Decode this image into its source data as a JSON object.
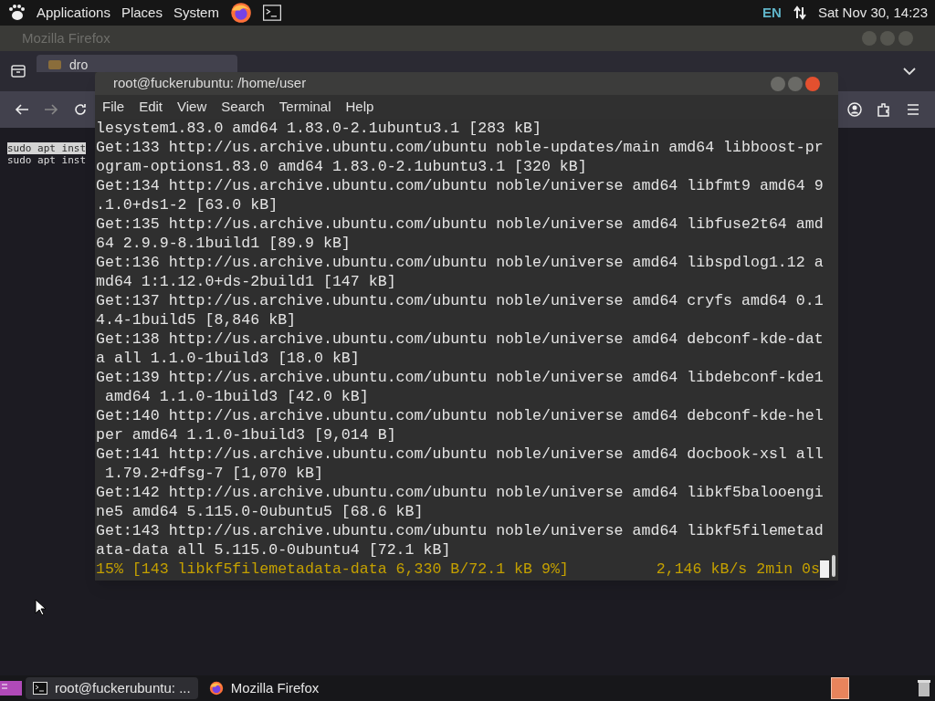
{
  "top_panel": {
    "menus": [
      "Applications",
      "Places",
      "System"
    ],
    "keyboard_layout": "EN",
    "clock": "Sat Nov 30, 14:23"
  },
  "browser": {
    "title": "Mozilla Firefox",
    "tab": {
      "title": "dro"
    },
    "content_lines": [
      {
        "text": "sudo apt inst",
        "selected": true
      },
      {
        "text": "sudo apt inst",
        "selected": false
      }
    ]
  },
  "terminal": {
    "title": "root@fuckerubuntu: /home/user",
    "menus": [
      "File",
      "Edit",
      "View",
      "Search",
      "Terminal",
      "Help"
    ],
    "lines": [
      "lesystem1.83.0 amd64 1.83.0-2.1ubuntu3.1 [283 kB]",
      "Get:133 http://us.archive.ubuntu.com/ubuntu noble-updates/main amd64 libboost-pr",
      "ogram-options1.83.0 amd64 1.83.0-2.1ubuntu3.1 [320 kB]",
      "Get:134 http://us.archive.ubuntu.com/ubuntu noble/universe amd64 libfmt9 amd64 9",
      ".1.0+ds1-2 [63.0 kB]",
      "Get:135 http://us.archive.ubuntu.com/ubuntu noble/universe amd64 libfuse2t64 amd",
      "64 2.9.9-8.1build1 [89.9 kB]",
      "Get:136 http://us.archive.ubuntu.com/ubuntu noble/universe amd64 libspdlog1.12 a",
      "md64 1:1.12.0+ds-2build1 [147 kB]",
      "Get:137 http://us.archive.ubuntu.com/ubuntu noble/universe amd64 cryfs amd64 0.1",
      "4.4-1build5 [8,846 kB]",
      "Get:138 http://us.archive.ubuntu.com/ubuntu noble/universe amd64 debconf-kde-dat",
      "a all 1.1.0-1build3 [18.0 kB]",
      "Get:139 http://us.archive.ubuntu.com/ubuntu noble/universe amd64 libdebconf-kde1",
      " amd64 1.1.0-1build3 [42.0 kB]",
      "Get:140 http://us.archive.ubuntu.com/ubuntu noble/universe amd64 debconf-kde-hel",
      "per amd64 1.1.0-1build3 [9,014 B]",
      "Get:141 http://us.archive.ubuntu.com/ubuntu noble/universe amd64 docbook-xsl all",
      " 1.79.2+dfsg-7 [1,070 kB]",
      "Get:142 http://us.archive.ubuntu.com/ubuntu noble/universe amd64 libkf5balooengi",
      "ne5 amd64 5.115.0-0ubuntu5 [68.6 kB]",
      "Get:143 http://us.archive.ubuntu.com/ubuntu noble/universe amd64 libkf5filemetad",
      "ata-data all 5.115.0-0ubuntu4 [72.1 kB]"
    ],
    "status_line": "15% [143 libkf5filemetadata-data 6,330 B/72.1 kB 9%]",
    "status_rate": "2,146 kB/s 2min 0s"
  },
  "taskbar": {
    "tasks": [
      {
        "label": "root@fuckerubuntu: ...",
        "kind": "terminal",
        "selected": true
      },
      {
        "label": "Mozilla Firefox",
        "kind": "browser",
        "selected": false
      }
    ]
  }
}
